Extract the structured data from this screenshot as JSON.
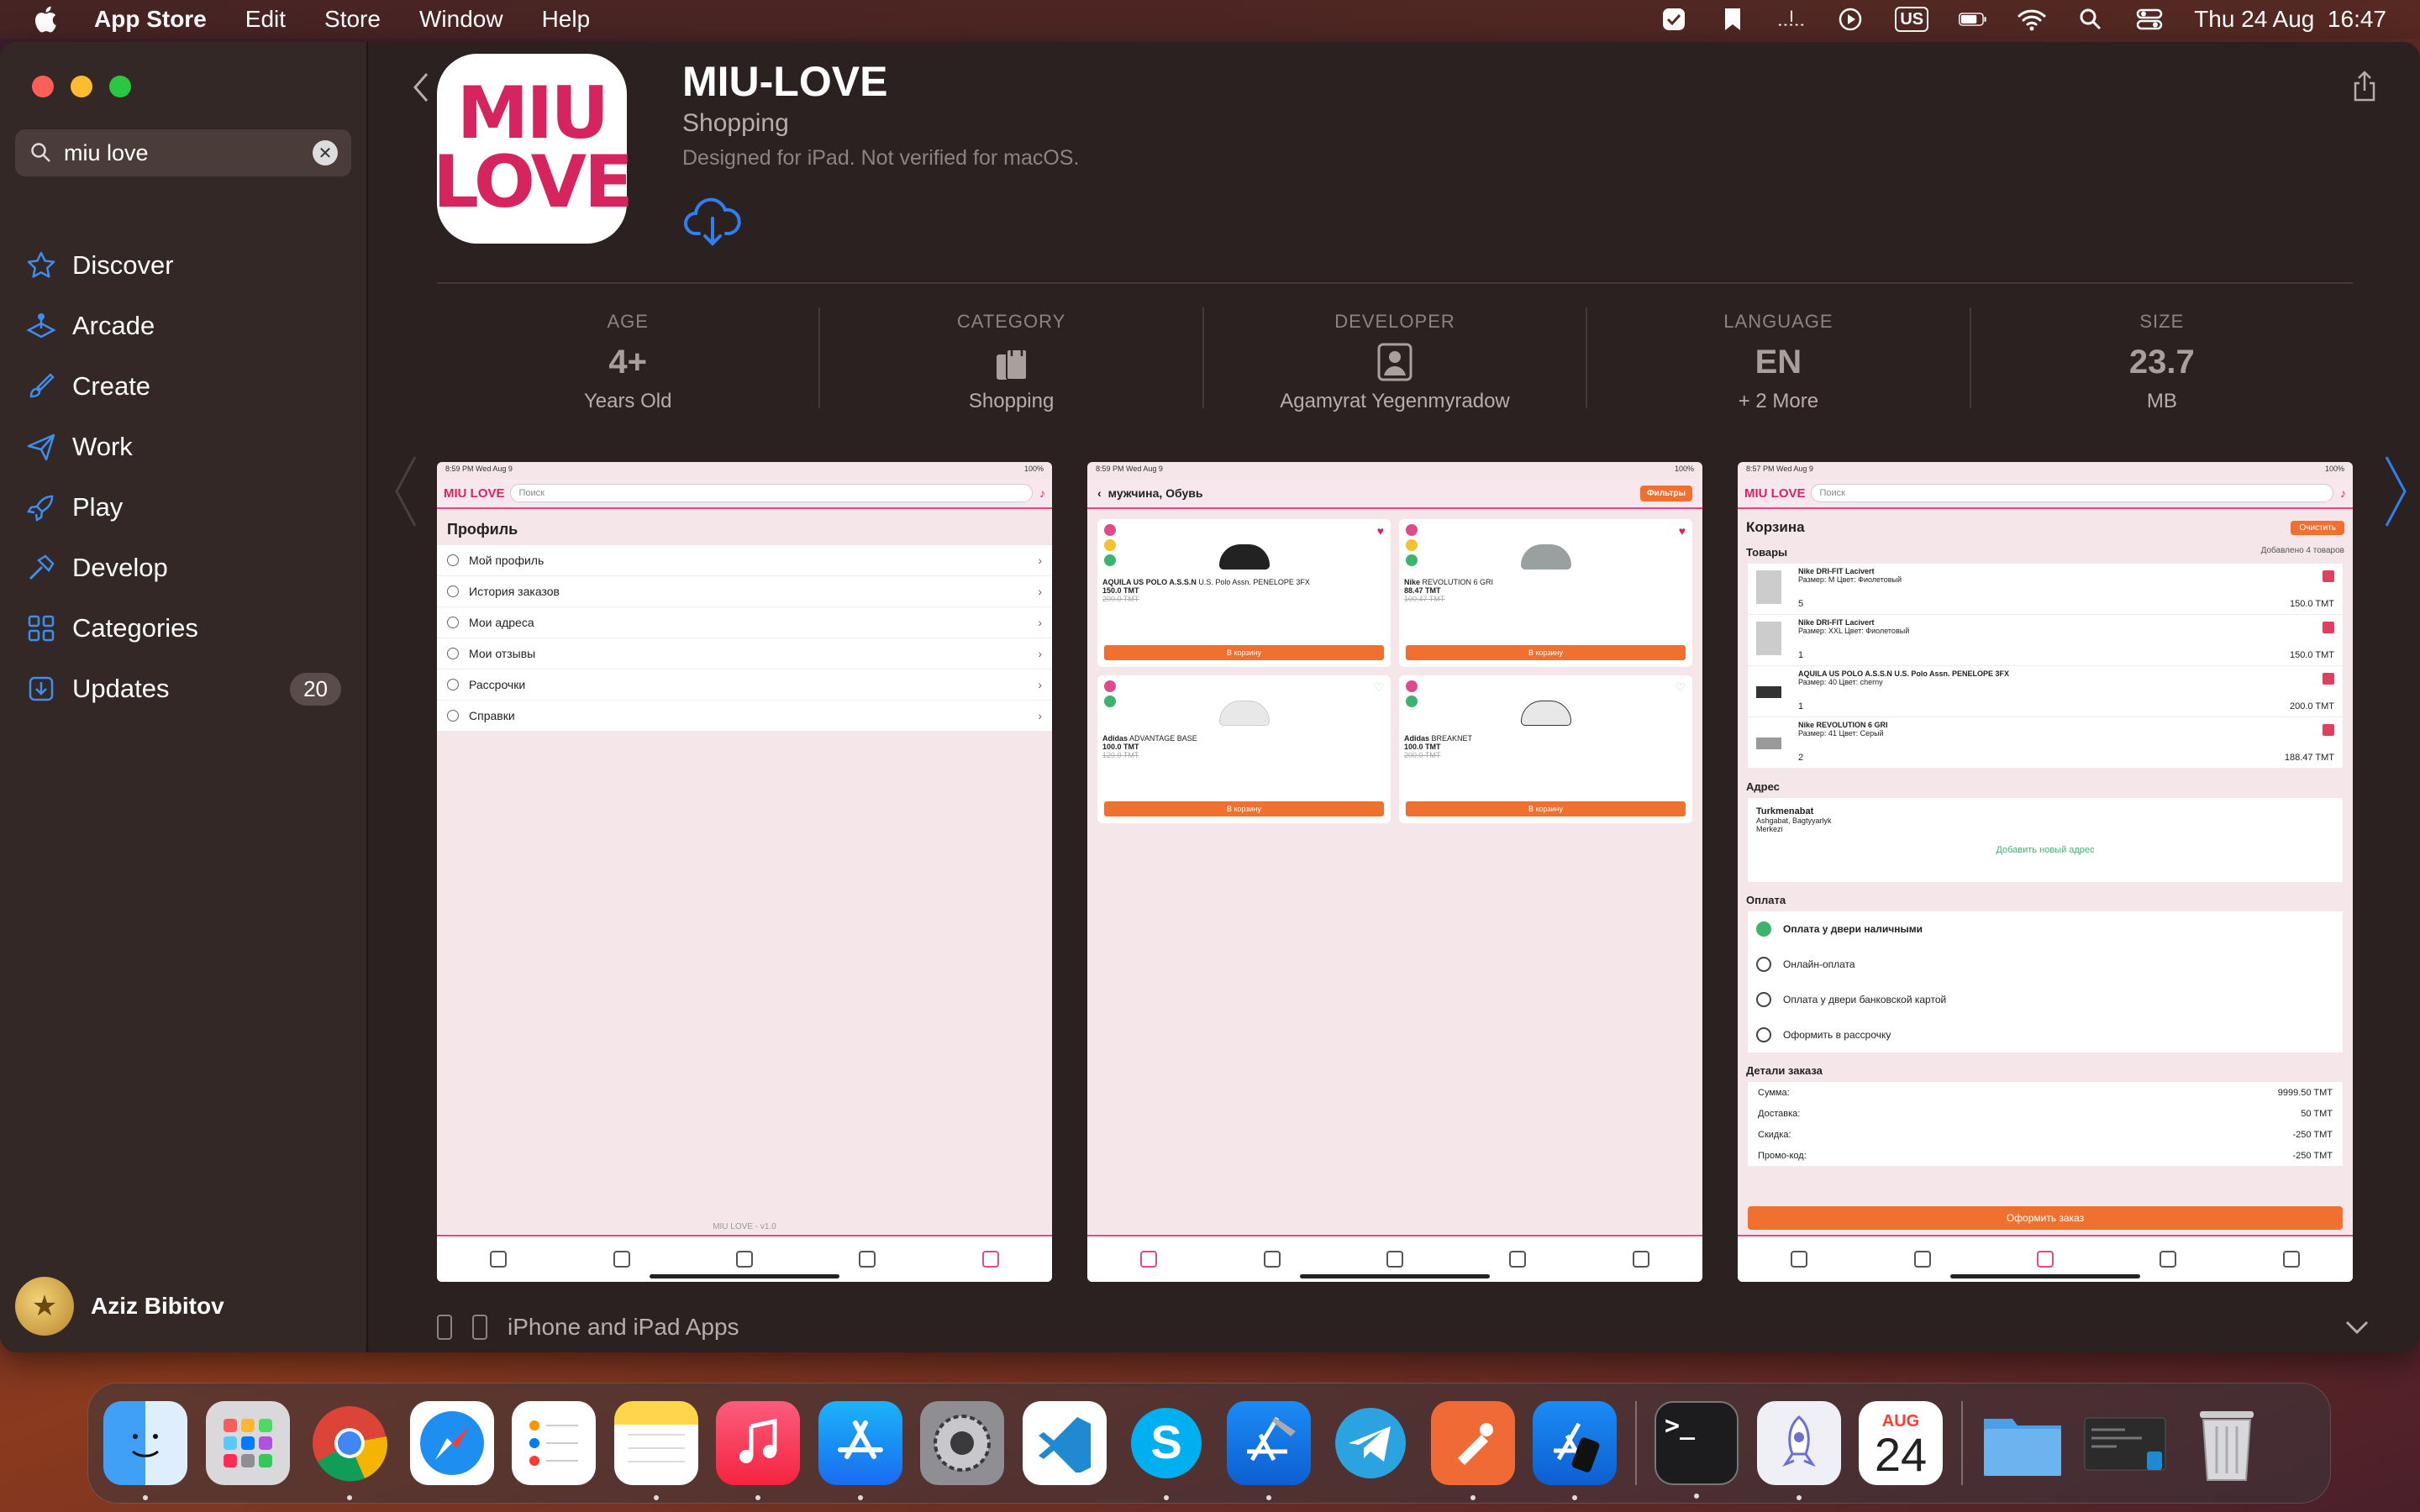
{
  "menubar": {
    "app_name": "App Store",
    "items": [
      "Edit",
      "Store",
      "Window",
      "Help"
    ],
    "keyboard": "US",
    "datetime": "Thu 24 Aug  16:47"
  },
  "sidebar": {
    "search_value": "miu love",
    "items": [
      {
        "label": "Discover",
        "icon": "star-icon"
      },
      {
        "label": "Arcade",
        "icon": "arcade-icon"
      },
      {
        "label": "Create",
        "icon": "brush-icon"
      },
      {
        "label": "Work",
        "icon": "paperplane-icon"
      },
      {
        "label": "Play",
        "icon": "rocket-icon"
      },
      {
        "label": "Develop",
        "icon": "hammer-icon"
      },
      {
        "label": "Categories",
        "icon": "grid-icon"
      },
      {
        "label": "Updates",
        "icon": "download-icon",
        "badge": "20"
      }
    ],
    "user_name": "Aziz Bibitov"
  },
  "app": {
    "title": "MIU-LOVE",
    "category": "Shopping",
    "note": "Designed for iPad. Not verified for macOS.",
    "icon_text_line1": "MIU",
    "icon_text_line2": "LOVE",
    "brand_color": "#d6245e"
  },
  "stats": [
    {
      "label": "AGE",
      "value": "4+",
      "sub": "Years Old"
    },
    {
      "label": "CATEGORY",
      "value": "",
      "sub": "Shopping"
    },
    {
      "label": "DEVELOPER",
      "value": "",
      "sub": "Agamyrat Yegenmyradow"
    },
    {
      "label": "LANGUAGE",
      "value": "EN",
      "sub": "+ 2 More"
    },
    {
      "label": "SIZE",
      "value": "23.7",
      "sub": "MB"
    }
  ],
  "shot1": {
    "status_time": "8:59 PM  Wed Aug 9",
    "status_batt": "100%",
    "logo": "MIU LOVE",
    "search": "Поиск",
    "title": "Профиль",
    "rows": [
      "Мой профиль",
      "История заказов",
      "Мои адреса",
      "Мои отзывы",
      "Рассрочки",
      "Справки"
    ],
    "version": "MIU LOVE - v1.0"
  },
  "shot2": {
    "status_time": "8:59 PM  Wed Aug 9",
    "status_batt": "100%",
    "header": "мужчина, Обувь",
    "filter": "Фильтры",
    "cards": [
      {
        "name": "AQUILA US POLO A.S.S.N",
        "sub": "U.S. Polo Assn. PENELOPE 3FX",
        "price": "150.0 TMT",
        "old": "200.0 TMT",
        "buy": "В корзину"
      },
      {
        "name": "Nike",
        "sub": "REVOLUTION 6 GRI",
        "price": "88.47 TMT",
        "old": "100.47 TMT",
        "buy": "В корзину"
      },
      {
        "name": "Adidas",
        "sub": "ADVANTAGE BASE",
        "price": "100.0 TMT",
        "old": "120.0 TMT",
        "buy": "В корзину"
      },
      {
        "name": "Adidas",
        "sub": "BREAKNET",
        "price": "100.0 TMT",
        "old": "200.0 TMT",
        "buy": "В корзину"
      }
    ]
  },
  "shot3": {
    "status_time": "8:57 PM  Wed Aug 9",
    "status_batt": "100%",
    "logo": "MIU LOVE",
    "search": "Поиск",
    "title": "Корзина",
    "clear": "Очистить",
    "goods": "Товары",
    "added": "Добавлено 4 товаров",
    "items": [
      {
        "name": "Nike DRI-FIT Lacivert",
        "meta": "Размер: M    Цвет: Фиолетовый",
        "qty": "5",
        "sum": "150.0 TMT"
      },
      {
        "name": "Nike DRI-FIT Lacivert",
        "meta": "Размер: XXL    Цвет: Фиолетовый",
        "qty": "1",
        "sum": "150.0 TMT"
      },
      {
        "name": "AQUILA US POLO A.S.S.N U.S. Polo Assn. PENELOPE 3FX",
        "meta": "Размер: 40    Цвет: cherny",
        "qty": "1",
        "sum": "200.0 TMT"
      },
      {
        "name": "Nike REVOLUTION 6 GRI",
        "meta": "Размер: 41    Цвет: Серый",
        "qty": "2",
        "sum": "188.47 TMT"
      }
    ],
    "address_title": "Адрес",
    "address_name": "Turkmenabat",
    "address_line1": "Ashgabat, Bagtyyarlyk",
    "address_line2": "Merkezi",
    "add_address": "Добавить новый адрес",
    "payment_title": "Оплата",
    "payments": [
      "Оплата у двери наличными",
      "Онлайн-оплата",
      "Оплата у двери банковской картой",
      "Оформить в рассрочку"
    ],
    "details_title": "Детали заказа",
    "details": [
      {
        "k": "Сумма:",
        "v": "9999.50 TMT"
      },
      {
        "k": "Доставка:",
        "v": "50 TMT"
      },
      {
        "k": "Скидка:",
        "v": "-250 TMT"
      },
      {
        "k": "Промо-код:",
        "v": "-250 TMT"
      }
    ],
    "order": "Оформить заказ"
  },
  "footer": {
    "section": "iPhone and iPad Apps"
  },
  "dock": {
    "calendar_month": "AUG",
    "calendar_day": "24",
    "terminal": ">_",
    "apps": [
      "Finder",
      "Launchpad",
      "Chrome",
      "Safari",
      "Reminders",
      "Notes",
      "Music",
      "App Store",
      "System Settings",
      "VS Code",
      "Skype",
      "Xcode",
      "Telegram",
      "Postman",
      "Simulator",
      "Terminal",
      "Rocket",
      "Calendar",
      "Downloads",
      "Window",
      "Trash"
    ]
  }
}
